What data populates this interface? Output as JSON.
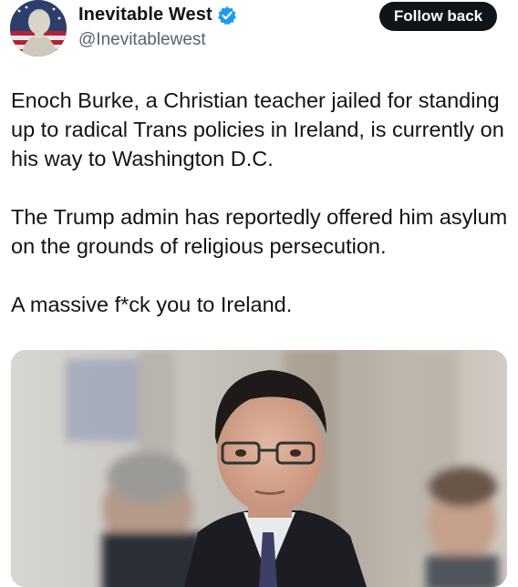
{
  "author": {
    "display_name": "Inevitable West",
    "handle": "@Inevitablewest",
    "verified": true,
    "avatar_icon": "statue-flag-avatar"
  },
  "actions": {
    "follow_label": "Follow back"
  },
  "tweet": {
    "paragraphs": [
      "Enoch Burke, a Christian teacher jailed for standing up to radical Trans policies in Ireland, is currently on his way to Washington D.C.",
      "The Trump admin has reportedly offered him asylum on the grounds of religious persecution.",
      "A massive f*ck you to Ireland."
    ]
  },
  "media": {
    "kind": "photo"
  },
  "colors": {
    "text": "#0f1419",
    "secondary_text": "#536471",
    "button_bg": "#0f1419",
    "verified_badge": "#1d9bf0"
  }
}
